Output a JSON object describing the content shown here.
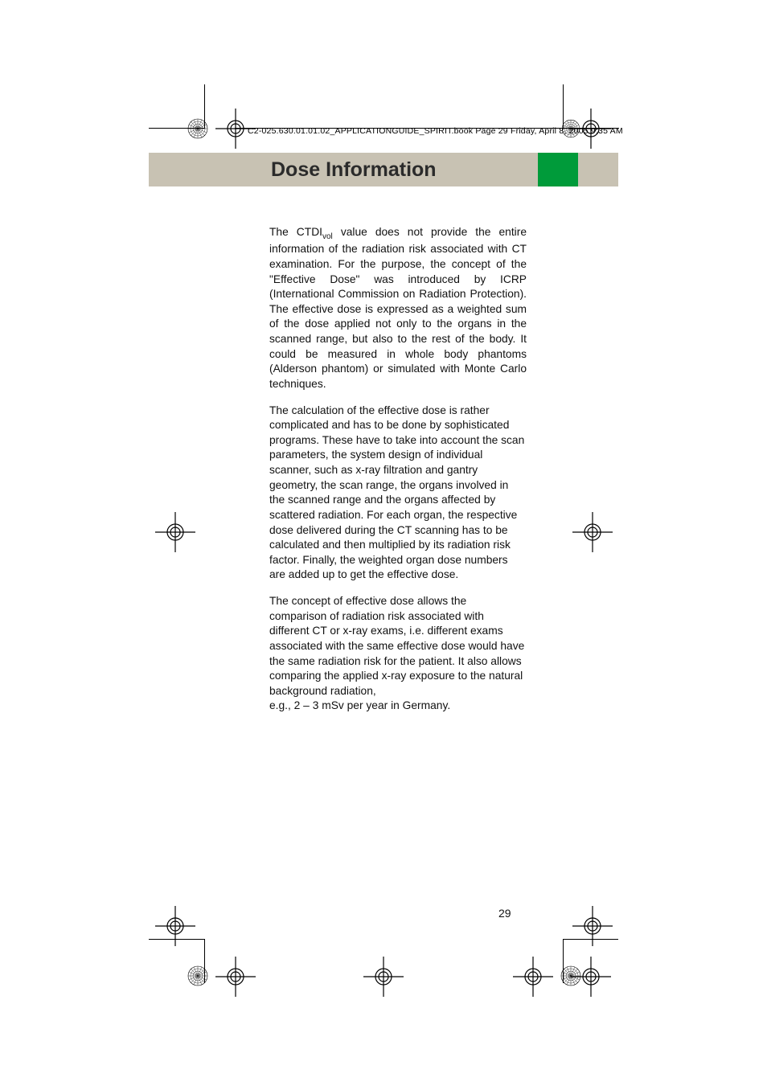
{
  "slug": "C2-025.630.01.01.02_APPLICATIONGUIDE_SPIRIT.book  Page 29  Friday, April 8, 2005  9:35 AM",
  "header": {
    "title": "Dose Information"
  },
  "body": {
    "p1a": "The CTDI",
    "p1sub": "vol",
    "p1b": " value does not provide the entire information of the radiation risk associated with CT examination. For the purpose, the concept of the \"Effective Dose\" was introduced by ICRP (International Commission on Radiation Protection). The effective dose is expressed as a weighted sum of the dose applied not only to the organs in the scanned range, but also to the rest of the body. It could be measured in whole body phantoms (Alderson phantom) or simulated with Monte Carlo techniques.",
    "p2": "The calculation of the effective dose is rather complicated and has to be done by sophisticated programs. These have to take into account the scan parameters, the system design of individual scanner, such as x-ray filtration and gantry geometry, the scan range, the organs involved in the scanned range and the organs affected by scattered radiation. For each organ, the respective dose delivered during the CT scanning has to be calculated and then multiplied by its radiation risk factor. Finally, the weighted organ dose numbers are added up to get the effective dose.",
    "p3": "The concept of effective dose allows the comparison of radiation risk associated with different CT or x-ray exams, i.e. different exams associated with the same effective dose would have the same radiation risk for the patient. It also allows comparing the applied x-ray exposure to the natural background radiation,",
    "p3line": "e.g., 2 – 3 mSv per year in Germany."
  },
  "page_number": "29"
}
